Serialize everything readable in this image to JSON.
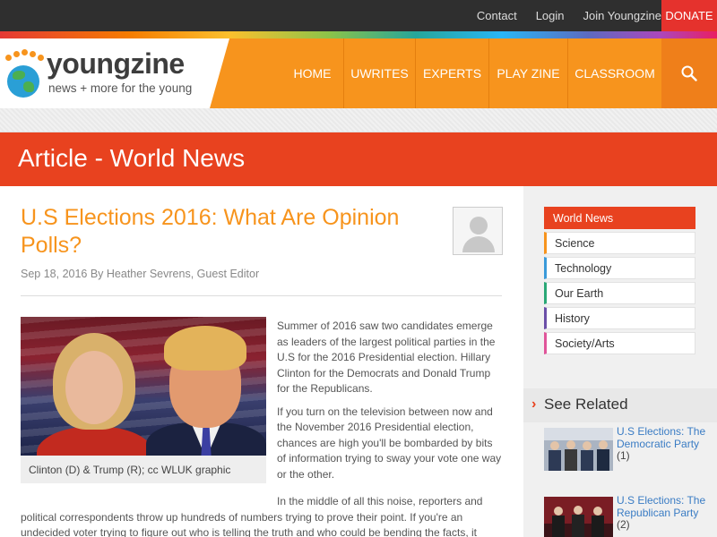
{
  "topbar": {
    "links": [
      "Contact",
      "Login",
      "Join Youngzine"
    ],
    "donate": "DONATE"
  },
  "brand": {
    "name": "youngzine",
    "tagline": "news + more for the young",
    "colors": {
      "orange": "#f7941d",
      "red": "#e8421f",
      "dark": "#2f2f2f"
    }
  },
  "nav": {
    "items": [
      "HOME",
      "UWRITES",
      "EXPERTS",
      "PLAY ZINE",
      "CLASSROOM"
    ],
    "search_icon": "search-icon"
  },
  "banner": {
    "title": "Article - World News"
  },
  "article": {
    "headline": "U.S Elections 2016: What Are Opinion Polls?",
    "byline": "Sep 18, 2016 By Heather Sevrens, Guest Editor",
    "photo_caption": "Clinton (D) & Trump (R); cc WLUK graphic",
    "paragraphs": [
      "Summer of 2016 saw two candidates emerge as leaders of the largest political parties in the U.S  for the 2016 Presidential election. Hillary Clinton for the Democrats and Donald Trump for the Republicans.",
      "If you turn on the television between now and the November 2016 Presidential election, chances are high you'll be bombarded by bits of information trying to sway your vote one way or the other."
    ],
    "paragraph_3": "In the middle of all this noise, reporters and political correspondents throw up hundreds of numbers trying to prove their point. If you're an undecided voter trying to figure out who is telling the truth and who could be bending the facts, it might be tempting"
  },
  "sidebar": {
    "categories": [
      {
        "label": "World News",
        "color": "#e8421f"
      },
      {
        "label": "Science",
        "color": "#f7941d"
      },
      {
        "label": "Technology",
        "color": "#3a9ad9"
      },
      {
        "label": "Our Earth",
        "color": "#2aa876"
      },
      {
        "label": "History",
        "color": "#6b4fa8"
      },
      {
        "label": "Society/Arts",
        "color": "#e0559a"
      }
    ],
    "see_related": "See Related",
    "related": [
      {
        "title": "U.S Elections: The Democratic Party",
        "count": "(1)"
      },
      {
        "title": "U.S Elections: The Republican Party",
        "count": "(2)"
      }
    ]
  }
}
